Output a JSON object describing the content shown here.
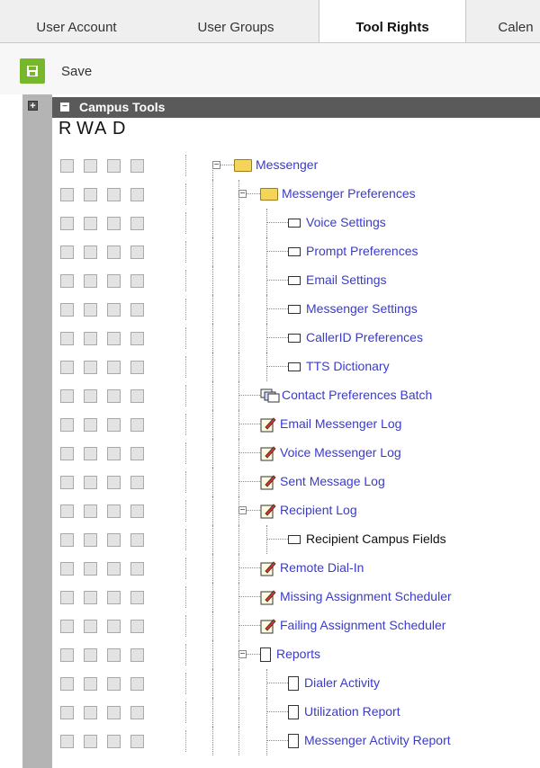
{
  "tabs": [
    {
      "label": "User Account",
      "active": false
    },
    {
      "label": "User Groups",
      "active": false
    },
    {
      "label": "Tool Rights",
      "active": true
    },
    {
      "label": "Calen",
      "active": false
    }
  ],
  "toolbar": {
    "save_label": "Save"
  },
  "section": {
    "title": "Campus Tools",
    "expand_all": "+",
    "collapse": "−"
  },
  "rights_header": [
    "R",
    "W",
    "A",
    "D"
  ],
  "tree": [
    {
      "label": "Messenger",
      "icon": "folder-icon",
      "level": 0,
      "toggle": "−"
    },
    {
      "label": "Messenger Preferences",
      "icon": "folder-icon",
      "level": 1,
      "toggle": "−"
    },
    {
      "label": "Voice Settings",
      "icon": "tab-icon",
      "level": 2
    },
    {
      "label": "Prompt Preferences",
      "icon": "tab-icon",
      "level": 2
    },
    {
      "label": "Email Settings",
      "icon": "tab-icon",
      "level": 2
    },
    {
      "label": "Messenger Settings",
      "icon": "tab-icon",
      "level": 2
    },
    {
      "label": "CallerID Preferences",
      "icon": "tab-icon",
      "level": 2
    },
    {
      "label": "TTS Dictionary",
      "icon": "tab-icon",
      "level": 2
    },
    {
      "label": "Contact Preferences Batch",
      "icon": "batch-icon",
      "level": 1
    },
    {
      "label": "Email Messenger Log",
      "icon": "edit-icon",
      "level": 1
    },
    {
      "label": "Voice Messenger Log",
      "icon": "edit-icon",
      "level": 1
    },
    {
      "label": "Sent Message Log",
      "icon": "edit-icon",
      "level": 1
    },
    {
      "label": "Recipient Log",
      "icon": "edit-icon",
      "level": 1,
      "toggle": "−"
    },
    {
      "label": "Recipient Campus Fields",
      "icon": "tab-icon",
      "level": 2,
      "dark": true
    },
    {
      "label": "Remote Dial-In",
      "icon": "edit-icon",
      "level": 1
    },
    {
      "label": "Missing Assignment Scheduler",
      "icon": "edit-icon",
      "level": 1
    },
    {
      "label": "Failing Assignment Scheduler",
      "icon": "edit-icon",
      "level": 1
    },
    {
      "label": "Reports",
      "icon": "document-icon",
      "level": 1,
      "toggle": "−"
    },
    {
      "label": "Dialer Activity",
      "icon": "document-icon",
      "level": 2
    },
    {
      "label": "Utilization Report",
      "icon": "document-icon",
      "level": 2
    },
    {
      "label": "Messenger Activity Report",
      "icon": "document-icon",
      "level": 2
    }
  ],
  "colors": {
    "link": "#3a3ad0",
    "save_green": "#77b72b",
    "header_bg": "#5a5a5a"
  }
}
